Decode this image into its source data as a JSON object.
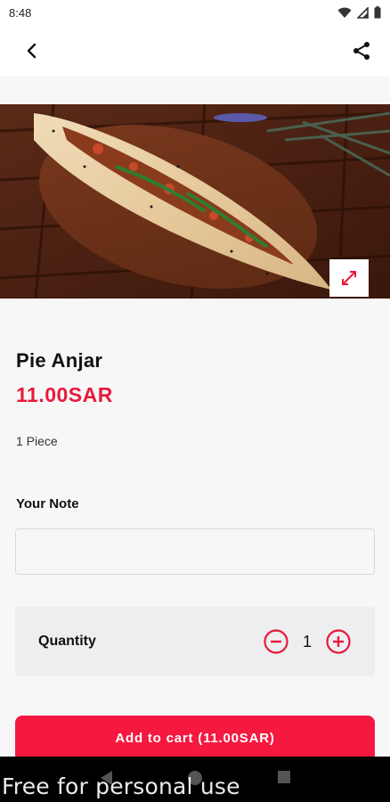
{
  "status_bar": {
    "time": "8:48"
  },
  "app_bar": {
    "back_icon": "chevron-left-icon",
    "share_icon": "share-icon"
  },
  "hero": {
    "expand_icon": "expand-icon"
  },
  "product": {
    "name": "Pie Anjar",
    "price": "11.00SAR",
    "unit": "1 Piece"
  },
  "note": {
    "label": "Your Note",
    "value": "",
    "placeholder": ""
  },
  "quantity": {
    "label": "Quantity",
    "value": "1",
    "decrement_icon": "minus-circle-icon",
    "increment_icon": "plus-circle-icon"
  },
  "cart": {
    "add_label": "Add to cart (11.00SAR)"
  },
  "watermark": "Free for personal use",
  "colors": {
    "accent": "#e8193b",
    "button": "#f5183f"
  }
}
